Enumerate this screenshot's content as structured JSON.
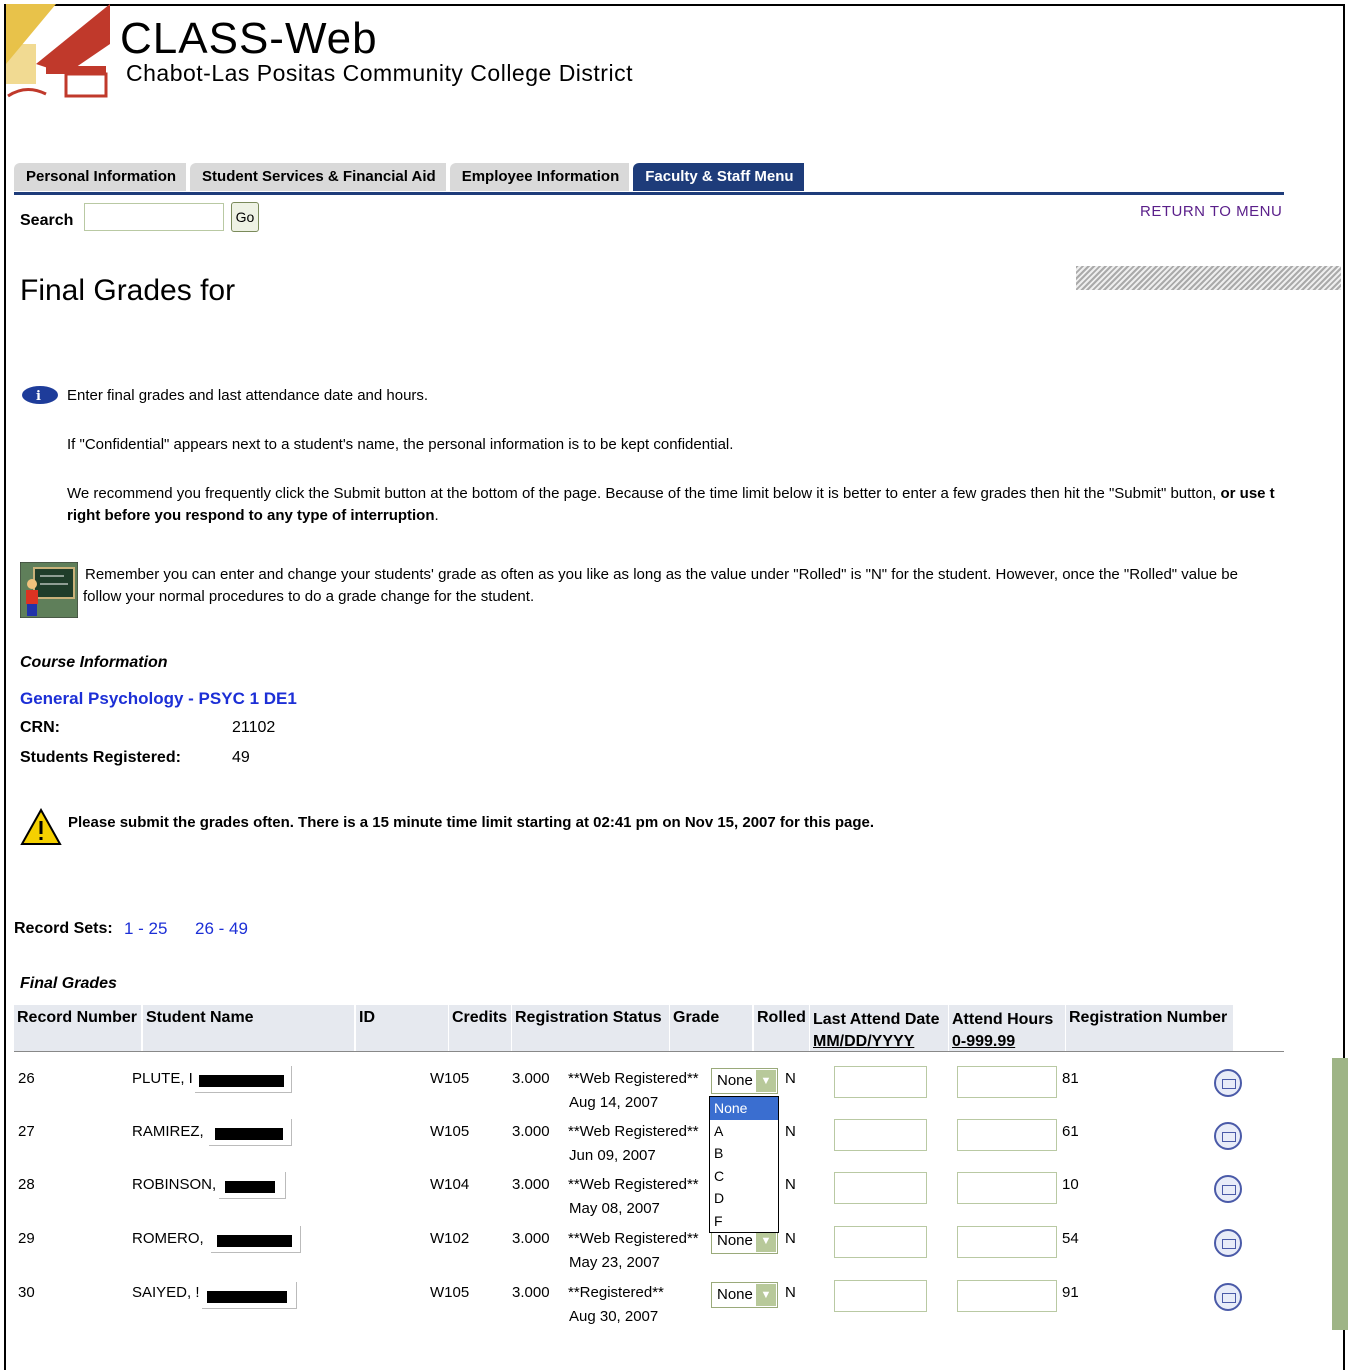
{
  "header": {
    "title": "CLASS-Web",
    "subtitle": "Chabot-Las Positas Community College District"
  },
  "tabs": [
    {
      "label": "Personal Information"
    },
    {
      "label": "Student Services & Financial Aid"
    },
    {
      "label": "Employee Information"
    },
    {
      "label": "Faculty & Staff Menu"
    }
  ],
  "search": {
    "label": "Search",
    "go": "Go"
  },
  "return_menu": "RETURN TO MENU",
  "page_title": "Final Grades for",
  "info": {
    "line1": "Enter final grades and last attendance date and hours.",
    "line2": "If \"Confidential\" appears next to a student's name, the personal information is to be kept confidential.",
    "line3a": "We recommend you frequently click the Submit button at the bottom of the page. Because of the time limit below it is better to enter a few grades then hit the \"Submit\" button, ",
    "line3b": "or use t",
    "line3c": "right before you respond to any type of interruption",
    "line3d": ".",
    "line4a": "Remember you can enter and change your students' grade as often as you like as long as the value under \"Rolled\" is \"N\" for the student. However, once the \"Rolled\" value be",
    "line4b": "follow your normal procedures to do a grade change for the student."
  },
  "course": {
    "heading": "Course Information",
    "name": "General Psychology - PSYC 1 DE1",
    "crn_label": "CRN:",
    "crn": "21102",
    "registered_label": "Students Registered:",
    "registered": "49"
  },
  "warning": "Please submit the grades often. There is a 15 minute time limit starting at 02:41 pm on Nov 15, 2007 for this page.",
  "record_sets": {
    "label": "Record Sets:",
    "set1": "1 - 25",
    "set2": "26 - 49"
  },
  "grades_heading": "Final Grades",
  "columns": {
    "record": "Record Number",
    "name": "Student Name",
    "id": "ID",
    "credits": "Credits",
    "status": "Registration Status",
    "grade": "Grade",
    "rolled": "Rolled",
    "last_attend": "Last Attend Date",
    "last_attend_fmt": "MM/DD/YYYY",
    "attend_hours": "Attend Hours",
    "attend_hours_fmt": "0-999.99",
    "reg_number": "Registration Number"
  },
  "rows": [
    {
      "rec": "26",
      "name": "PLUTE, I",
      "id": "W105",
      "credits": "3.000",
      "status": "**Web Registered**",
      "date": "Aug 14, 2007",
      "grade": "None",
      "rolled": "N",
      "regnum": "81"
    },
    {
      "rec": "27",
      "name": "RAMIREZ,",
      "id": "W105",
      "credits": "3.000",
      "status": "**Web Registered**",
      "date": "Jun 09, 2007",
      "grade": "None",
      "rolled": "N",
      "regnum": "61"
    },
    {
      "rec": "28",
      "name": "ROBINSON,",
      "id": "W104",
      "credits": "3.000",
      "status": "**Web Registered**",
      "date": "May 08, 2007",
      "grade": "None",
      "rolled": "N",
      "regnum": "10"
    },
    {
      "rec": "29",
      "name": "ROMERO,",
      "id": "W102",
      "credits": "3.000",
      "status": "**Web Registered**",
      "date": "May 23, 2007",
      "grade": "None",
      "rolled": "N",
      "regnum": "54"
    },
    {
      "rec": "30",
      "name": "SAIYED, !",
      "id": "W105",
      "credits": "3.000",
      "status": "**Registered**",
      "date": "Aug 30, 2007",
      "grade": "None",
      "rolled": "N",
      "regnum": "91"
    }
  ],
  "grade_options": [
    "None",
    "A",
    "B",
    "C",
    "D",
    "F"
  ]
}
